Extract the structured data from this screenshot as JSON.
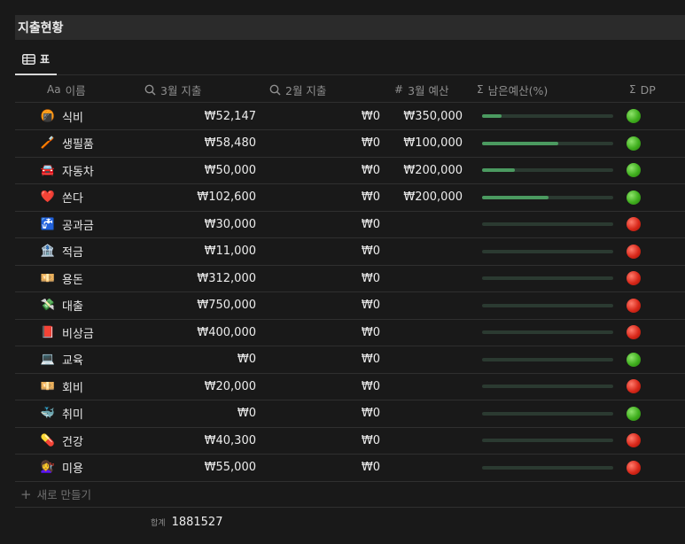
{
  "page": {
    "title": "지출현황"
  },
  "view": {
    "tab_label": "표"
  },
  "columns": {
    "name": {
      "icon": "Aa",
      "label": "이름"
    },
    "march": {
      "icon": "search-icon",
      "label": "3월 지출"
    },
    "feb": {
      "icon": "search-icon",
      "label": "2월 지출"
    },
    "budget": {
      "icon": "#",
      "label": "3월 예산"
    },
    "remaining": {
      "icon": "Σ",
      "label": "남은예산(%)"
    },
    "dp": {
      "icon": "Σ",
      "label": "DP"
    }
  },
  "rows": [
    {
      "emoji": "🍘",
      "name": "식비",
      "march": "₩52,147",
      "feb": "₩0",
      "budget": "₩350,000",
      "remaining_fraction": 0.15,
      "dp": "green"
    },
    {
      "emoji": "🪥",
      "name": "생필품",
      "march": "₩58,480",
      "feb": "₩0",
      "budget": "₩100,000",
      "remaining_fraction": 0.58,
      "dp": "green"
    },
    {
      "emoji": "🚘",
      "name": "자동차",
      "march": "₩50,000",
      "feb": "₩0",
      "budget": "₩200,000",
      "remaining_fraction": 0.25,
      "dp": "green"
    },
    {
      "emoji": "❤️",
      "name": "쏜다",
      "march": "₩102,600",
      "feb": "₩0",
      "budget": "₩200,000",
      "remaining_fraction": 0.51,
      "dp": "green"
    },
    {
      "emoji": "🚰",
      "name": "공과금",
      "march": "₩30,000",
      "feb": "₩0",
      "budget": "",
      "remaining_fraction": 0,
      "dp": "red"
    },
    {
      "emoji": "🏦",
      "name": "적금",
      "march": "₩11,000",
      "feb": "₩0",
      "budget": "",
      "remaining_fraction": 0,
      "dp": "red"
    },
    {
      "emoji": "💴",
      "name": "용돈",
      "march": "₩312,000",
      "feb": "₩0",
      "budget": "",
      "remaining_fraction": 0,
      "dp": "red"
    },
    {
      "emoji": "💸",
      "name": "대출",
      "march": "₩750,000",
      "feb": "₩0",
      "budget": "",
      "remaining_fraction": 0,
      "dp": "red"
    },
    {
      "emoji": "📕",
      "name": "비상금",
      "march": "₩400,000",
      "feb": "₩0",
      "budget": "",
      "remaining_fraction": 0,
      "dp": "red"
    },
    {
      "emoji": "💻",
      "name": "교육",
      "march": "₩0",
      "feb": "₩0",
      "budget": "",
      "remaining_fraction": 0,
      "dp": "green"
    },
    {
      "emoji": "💴",
      "name": "회비",
      "march": "₩20,000",
      "feb": "₩0",
      "budget": "",
      "remaining_fraction": 0,
      "dp": "red"
    },
    {
      "emoji": "🐳",
      "name": "취미",
      "march": "₩0",
      "feb": "₩0",
      "budget": "",
      "remaining_fraction": 0,
      "dp": "green"
    },
    {
      "emoji": "💊",
      "name": "건강",
      "march": "₩40,300",
      "feb": "₩0",
      "budget": "",
      "remaining_fraction": 0,
      "dp": "red"
    },
    {
      "emoji": "💇‍♀️",
      "name": "미용",
      "march": "₩55,000",
      "feb": "₩0",
      "budget": "",
      "remaining_fraction": 0,
      "dp": "red"
    }
  ],
  "new_row": {
    "label": "새로 만들기"
  },
  "footer": {
    "sum_label": "합계",
    "sum_value": "1881527"
  }
}
